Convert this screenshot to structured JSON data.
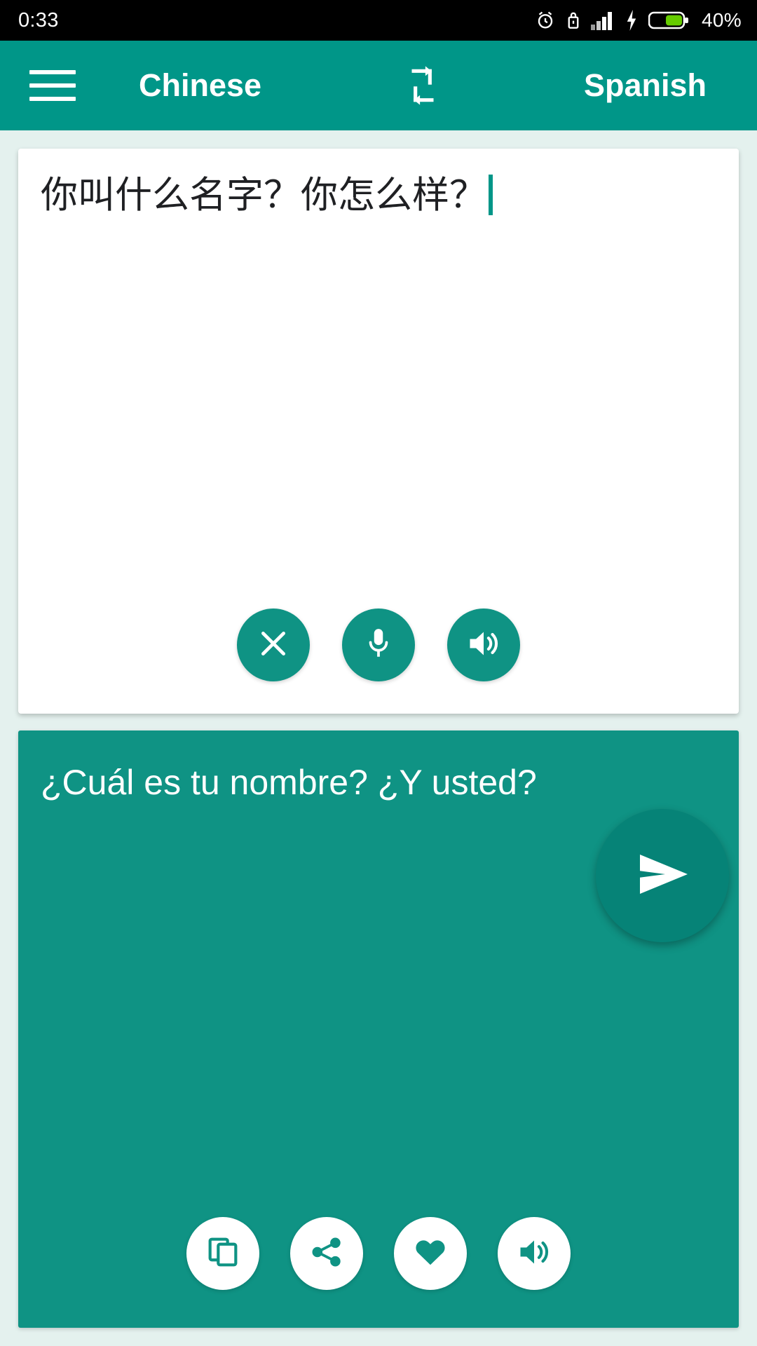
{
  "status_bar": {
    "clock": "0:33",
    "battery_percent": "40%",
    "icons": [
      "alarm-icon",
      "lock-icon",
      "signal-icon",
      "charging-bolt-icon",
      "battery-icon"
    ]
  },
  "app_bar": {
    "menu_icon": "hamburger-menu-icon",
    "source_language": "Chinese",
    "swap_icon": "swap-languages-icon",
    "target_language": "Spanish"
  },
  "source_panel": {
    "text": "你叫什么名字？你怎么样？",
    "caret_visible": true,
    "actions": [
      {
        "name": "clear-button",
        "icon": "close-x-icon"
      },
      {
        "name": "voice-input-button",
        "icon": "microphone-icon"
      },
      {
        "name": "speak-source-button",
        "icon": "speaker-icon"
      }
    ]
  },
  "translate_button": {
    "name": "send-translate-button",
    "icon": "send-icon"
  },
  "target_panel": {
    "text": "¿Cuál es tu nombre? ¿Y usted?",
    "actions": [
      {
        "name": "copy-button",
        "icon": "copy-icon"
      },
      {
        "name": "share-button",
        "icon": "share-icon"
      },
      {
        "name": "favorite-button",
        "icon": "heart-icon"
      },
      {
        "name": "speak-translation-button",
        "icon": "speaker-icon"
      }
    ]
  },
  "colors": {
    "primary": "#009688",
    "panel": "#0f9384",
    "fab": "#068377",
    "background": "#e4f1ee",
    "card": "#ffffff",
    "status_bar": "#000000",
    "battery_fill": "#66cc00",
    "caret": "#009688"
  }
}
